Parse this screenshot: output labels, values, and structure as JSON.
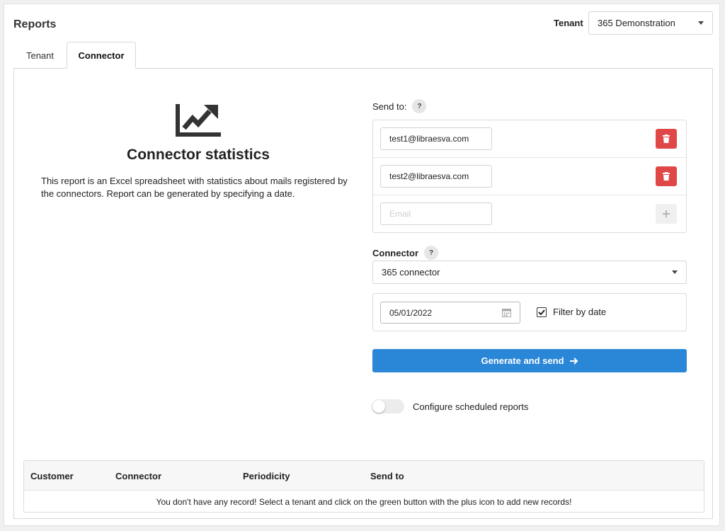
{
  "header": {
    "title": "Reports",
    "tenant_label": "Tenant",
    "tenant_value": "365 Demonstration"
  },
  "tabs": [
    {
      "label": "Tenant",
      "active": false
    },
    {
      "label": "Connector",
      "active": true
    }
  ],
  "left": {
    "icon": "chart-line-up-icon",
    "title": "Connector statistics",
    "description": "This report is an Excel spreadsheet with statistics about mails registered by the connectors. Report can be generated by specifying a date."
  },
  "form": {
    "send_to_label": "Send to:",
    "help_glyph": "?",
    "emails": [
      "test1@libraesva.com",
      "test2@libraesva.com"
    ],
    "email_placeholder": "Email",
    "connector_label": "Connector",
    "connector_value": "365 connector",
    "date_value": "05/01/2022",
    "filter_by_date_label": "Filter by date",
    "filter_by_date_checked": true,
    "generate_label": "Generate and send",
    "schedule_label": "Configure scheduled reports",
    "schedule_enabled": false
  },
  "table": {
    "columns": [
      "Customer",
      "Connector",
      "Periodicity",
      "Send to"
    ],
    "empty_message": "You don't have any record! Select a tenant and click on the green button with the plus icon to add new records!"
  },
  "colors": {
    "primary": "#2a86d6",
    "danger": "#e04848",
    "border": "#dcdcdc"
  }
}
